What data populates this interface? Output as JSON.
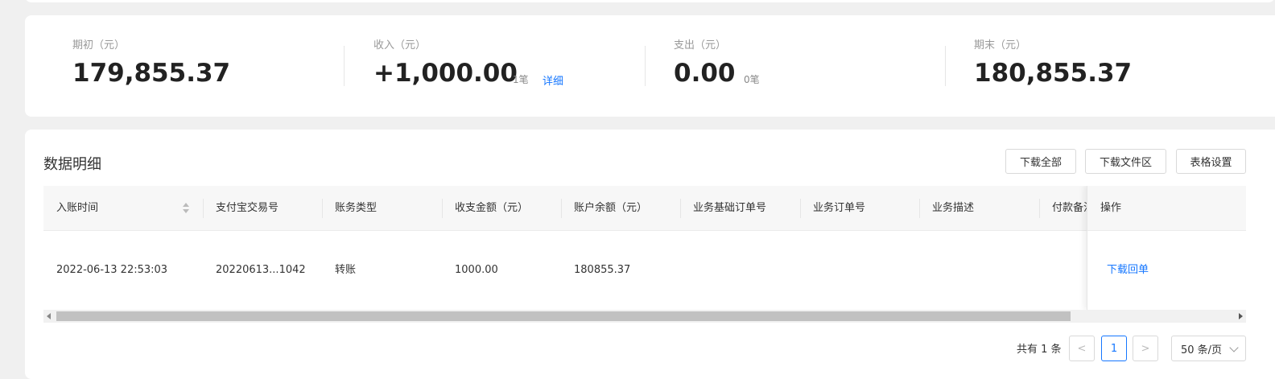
{
  "summary": {
    "opening": {
      "label": "期初（元）",
      "value": "179,855.37"
    },
    "income": {
      "label": "收入（元）",
      "value": "+1,000.00",
      "count": "1笔",
      "link": "详细"
    },
    "expense": {
      "label": "支出（元）",
      "value": "0.00",
      "count": "0笔"
    },
    "closing": {
      "label": "期末（元）",
      "value": "180,855.37"
    }
  },
  "detail": {
    "title": "数据明细",
    "buttons": {
      "download_all": "下载全部",
      "download_area": "下载文件区",
      "table_settings": "表格设置"
    }
  },
  "table": {
    "columns": [
      "入账时间",
      "支付宝交易号",
      "账务类型",
      "收支金额（元）",
      "账户余额（元）",
      "业务基础订单号",
      "业务订单号",
      "业务描述",
      "付款备注",
      "操作"
    ],
    "rows": [
      {
        "time": "2022-06-13 22:53:03",
        "trade_no": "20220613...1042",
        "type": "转账",
        "amount": "1000.00",
        "balance": "180855.37",
        "action": "下载回单"
      }
    ]
  },
  "pagination": {
    "total": "共有 1 条",
    "current_page": "1",
    "page_size": "50 条/页",
    "prev": "<",
    "next": ">"
  }
}
